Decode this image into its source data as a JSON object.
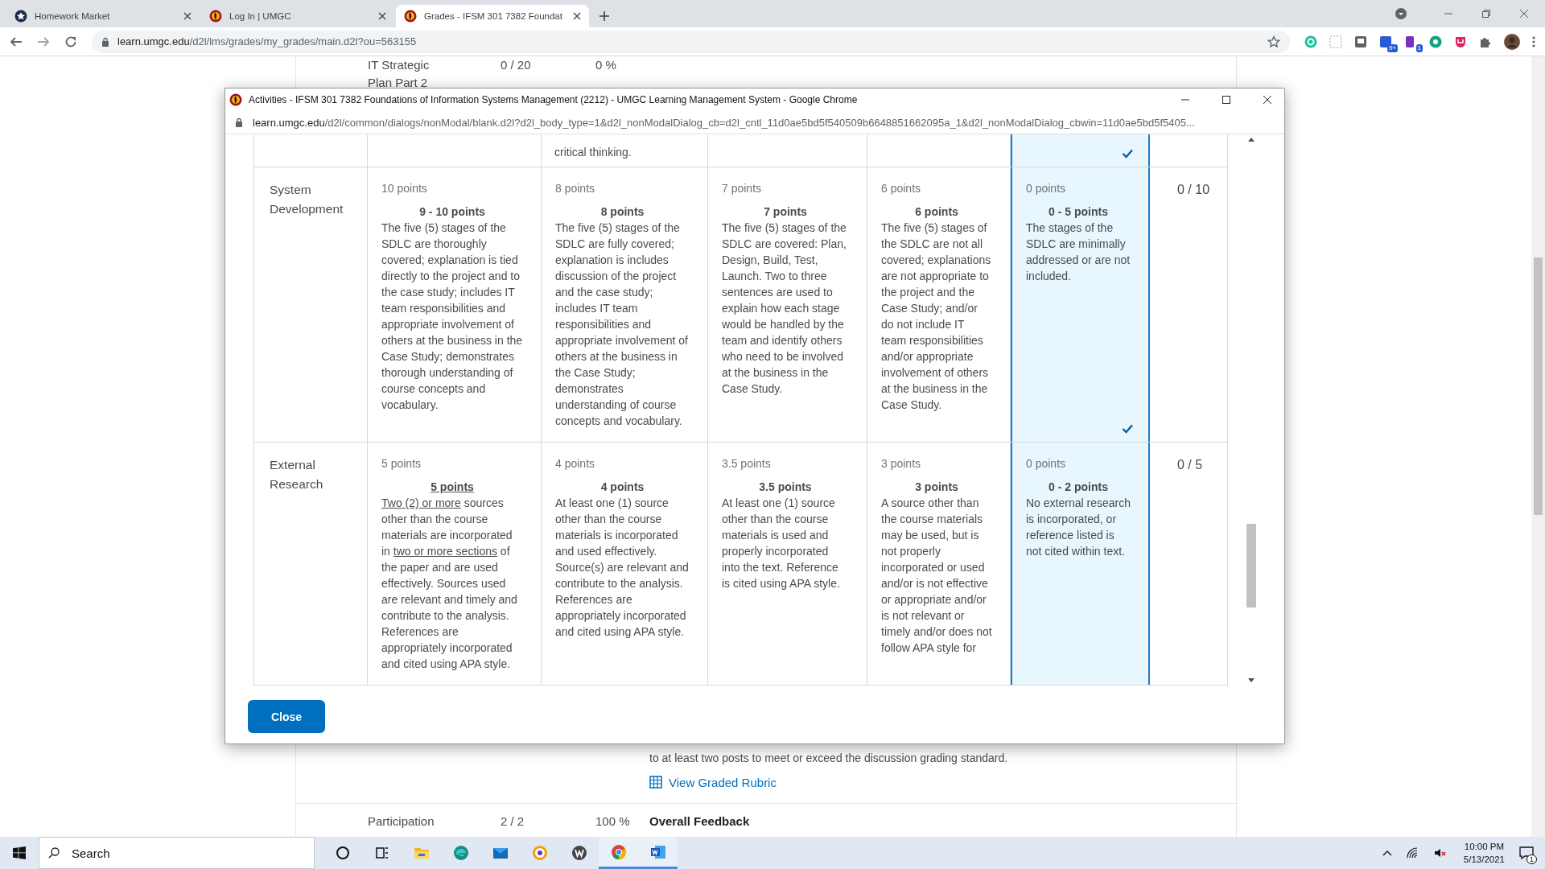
{
  "browser": {
    "tabs": [
      {
        "title": "Homework Market",
        "kind": "star",
        "selected": false
      },
      {
        "title": "Log In | UMGC",
        "kind": "flame",
        "selected": false
      },
      {
        "title": "Grades - IFSM 301 7382 Foundat",
        "kind": "flame",
        "selected": true
      }
    ],
    "url": {
      "domain": "learn.umgc.edu",
      "path": "/d2l/lms/grades/my_grades/main.d2l?ou=563155"
    },
    "extensions": [
      {
        "kind": "grammar"
      },
      {
        "kind": "dashed"
      },
      {
        "kind": "square"
      },
      {
        "kind": "blue",
        "badge": "9+"
      },
      {
        "kind": "purple",
        "badge": "1"
      },
      {
        "kind": "green"
      },
      {
        "kind": "red"
      },
      {
        "kind": "puzzle"
      }
    ]
  },
  "grades_top": {
    "item": "IT Strategic Plan Part 2",
    "score": "0 / 20",
    "percent": "0 %"
  },
  "dialog": {
    "title": "Activities - IFSM 301 7382 Foundations of Information Systems Management (2212) - UMGC Learning Management System - Google Chrome",
    "url": {
      "domain": "learn.umgc.edu",
      "path": "/d2l/common/dialogs/nonModal/blank.d2l?d2l_body_type=1&d2l_nonModalDialog_cb=d2l_cntl_11d0ae5bd5f540509b6648851662095a_1&d2l_nonModalDialog_cbwin=11d0ae5bd5f5405..."
    },
    "rubric": {
      "partial_row": {
        "levels": [
          {
            "selected": false,
            "check": false
          },
          {
            "text": "critical thinking.",
            "selected": false,
            "check": false
          },
          {
            "selected": false,
            "check": false
          },
          {
            "selected": false,
            "check": false
          },
          {
            "selected": true,
            "check": true
          }
        ]
      },
      "rows": [
        {
          "criterion": "System Development",
          "score": "0 / 10",
          "levels": [
            {
              "points": "10 points",
              "heading": "9 - 10 points",
              "underlined": false,
              "text": "The five (5) stages of the SDLC are thoroughly covered; explanation is tied directly to the project and to the case study; includes IT team responsibilities and appropriate involvement of others at the business in the Case Study; demonstrates thorough understanding of course concepts and vocabulary.",
              "selected": false,
              "check": false
            },
            {
              "points": "8 points",
              "heading": "8 points",
              "underlined": false,
              "text": "The five (5) stages of the SDLC are fully covered; explanation is includes discussion of the project and the case study; includes IT team responsibilities and appropriate involvement of others at the business in the Case Study; demonstrates understanding of course concepts and vocabulary.",
              "selected": false,
              "check": false
            },
            {
              "points": "7 points",
              "heading": "7 points",
              "underlined": false,
              "text": "The five (5) stages of the SDLC are covered: Plan, Design, Build, Test, Launch.  Two to three sentences are used to explain how each stage would be handled by the team and identify others who need to be involved at the business in the Case Study.",
              "selected": false,
              "check": false
            },
            {
              "points": "6 points",
              "heading": "6 points",
              "underlined": false,
              "text": "The five (5) stages of the SDLC are not all covered; explanations are not appropriate to the project and the Case Study; and/or do not include IT team responsibilities and/or appropriate involvement of others at the business in the Case Study.",
              "selected": false,
              "check": false
            },
            {
              "points": "0 points",
              "heading": "0 - 5 points",
              "underlined": false,
              "text": "The stages of the SDLC are minimally addressed or are not included.",
              "selected": true,
              "check": true
            }
          ]
        },
        {
          "criterion": "External Research",
          "score": "0 / 5",
          "levels": [
            {
              "points": "5 points",
              "heading": "5 points",
              "underlined": true,
              "segments": [
                {
                  "text": "Two (2) or more",
                  "underlined": true
                },
                {
                  "text": " sources other than the course materials are incorporated in ",
                  "underlined": false
                },
                {
                  "text": "two or more sections",
                  "underlined": true
                },
                {
                  "text": " of the paper and are used effectively. Sources used are relevant and timely and contribute to the analysis. References are appropriately incorporated and cited using APA style.",
                  "underlined": false
                }
              ],
              "selected": false,
              "check": false
            },
            {
              "points": "4 points",
              "heading": "4 points",
              "underlined": false,
              "text": "At least one (1) source other than the course materials is incorporated and used effectively. Source(s) are relevant and contribute to the analysis. References are appropriately incorporated and cited using APA style.",
              "selected": false,
              "check": false
            },
            {
              "points": "3.5 points",
              "heading": "3.5 points",
              "underlined": false,
              "text": "At least one (1) source other than the course materials is used and properly incorporated into the text. Reference is cited using APA style.",
              "selected": false,
              "check": false
            },
            {
              "points": "3 points",
              "heading": "3 points",
              "underlined": false,
              "text": "A source other than the course materials may be used, but is not properly incorporated or used and/or is not effective or appropriate and/or is not relevant or timely and/or does not follow APA style for",
              "selected": false,
              "check": false
            },
            {
              "points": "0 points",
              "heading": "0 - 2 points",
              "underlined": false,
              "text": "No external research is incorporated, or reference listed is not cited within text.",
              "selected": true,
              "check": false
            }
          ]
        }
      ]
    },
    "close_button": "Close"
  },
  "feedback_text": "to at least two posts to meet or exceed the discussion grading standard.",
  "view_rubric_link": "View Graded Rubric",
  "participation": {
    "item": "Participation",
    "score": "2 / 2",
    "percent": "100 %",
    "feedback_heading": "Overall Feedback"
  },
  "taskbar": {
    "search_placeholder": "Search",
    "apps": [
      {
        "kind": "cortana",
        "active": false
      },
      {
        "kind": "taskview",
        "active": false
      },
      {
        "kind": "folder",
        "active": false
      },
      {
        "kind": "edge",
        "active": false
      },
      {
        "kind": "mail",
        "active": false
      },
      {
        "kind": "ring",
        "active": false
      },
      {
        "kind": "wapp",
        "active": false
      },
      {
        "kind": "chrome",
        "active": true
      },
      {
        "kind": "word",
        "active": true
      }
    ],
    "time": "10:00 PM",
    "date": "5/13/2021",
    "notifications": "1"
  }
}
